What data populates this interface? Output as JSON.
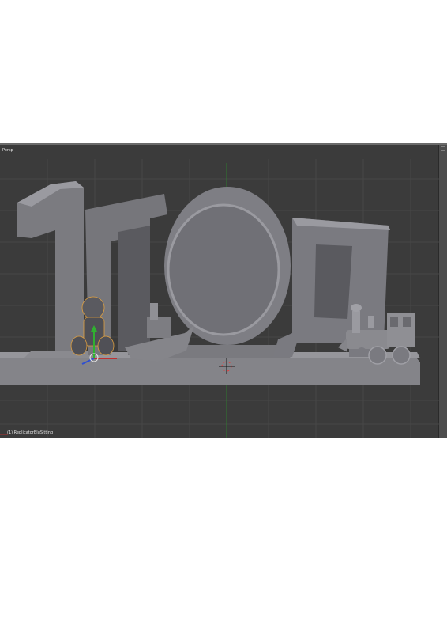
{
  "viewport": {
    "view_label": "Persp",
    "object_label": "(1) ReplicatorBluSitting"
  },
  "icons": {
    "cursor": "3d-cursor-icon",
    "gizmo": "transform-gizmo-icon",
    "corner": "corner-widget-icon"
  },
  "colors": {
    "background": "#3b3b3b",
    "grid": "#4a4a4a",
    "model": "#7d7d82",
    "y_axis": "#2f7a2f",
    "x_axis": "#b03030"
  }
}
